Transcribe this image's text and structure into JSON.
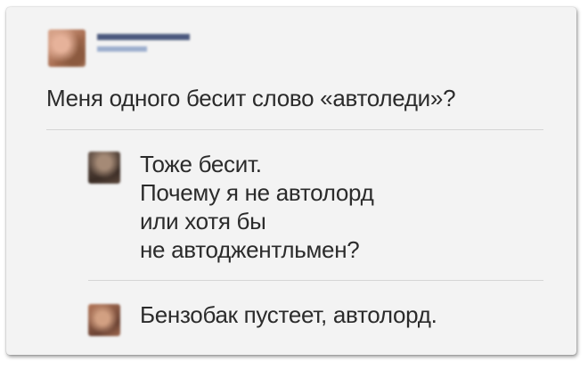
{
  "post": {
    "text": "Меня одного бесит слово «автоледи»?"
  },
  "replies": [
    {
      "lines": [
        "Тоже бесит.",
        "Почему я не автолорд",
        "или хотя бы",
        "не автоджентльмен?"
      ]
    },
    {
      "lines": [
        "Бензобак пустеет, автолорд."
      ]
    }
  ],
  "colors": {
    "card_background": "#f3f3f3",
    "text": "#2b2b2b",
    "divider": "#d5d5d5",
    "author_name": "#2f3f6a",
    "author_meta": "#8ea3c8"
  },
  "icons": {
    "author_avatar": "avatar-icon",
    "reply_avatar": "avatar-icon"
  }
}
